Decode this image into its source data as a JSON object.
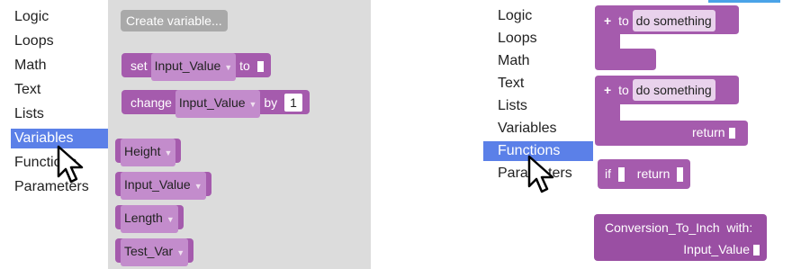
{
  "left": {
    "categories": [
      "Logic",
      "Loops",
      "Math",
      "Text",
      "Lists",
      "Variables",
      "Functions",
      "Parameters"
    ],
    "selected_index": 5,
    "create_variable_button": "Create variable...",
    "blocks": {
      "set_label": "set",
      "set_var": "Input_Value",
      "set_to": "to",
      "change_label": "change",
      "change_var": "Input_Value",
      "change_by": "by",
      "change_num": "1",
      "vars": [
        "Height",
        "Input_Value",
        "Length",
        "Test_Var"
      ]
    }
  },
  "right": {
    "categories": [
      "Logic",
      "Loops",
      "Math",
      "Text",
      "Lists",
      "Variables",
      "Functions",
      "Parameters"
    ],
    "selected_index": 6,
    "blocks": {
      "plus": "+",
      "to_label": "to",
      "func_name_1": "do something",
      "func_name_2": "do something",
      "return_label": "return",
      "if_label": "if",
      "if_return": "return",
      "call_name": "Conversion_To_Inch",
      "call_with": "with:",
      "call_param": "Input_Value"
    }
  },
  "colors": {
    "accent": "#5b80e8",
    "block": "#a55bad",
    "flyout": "#dcdcdc"
  }
}
